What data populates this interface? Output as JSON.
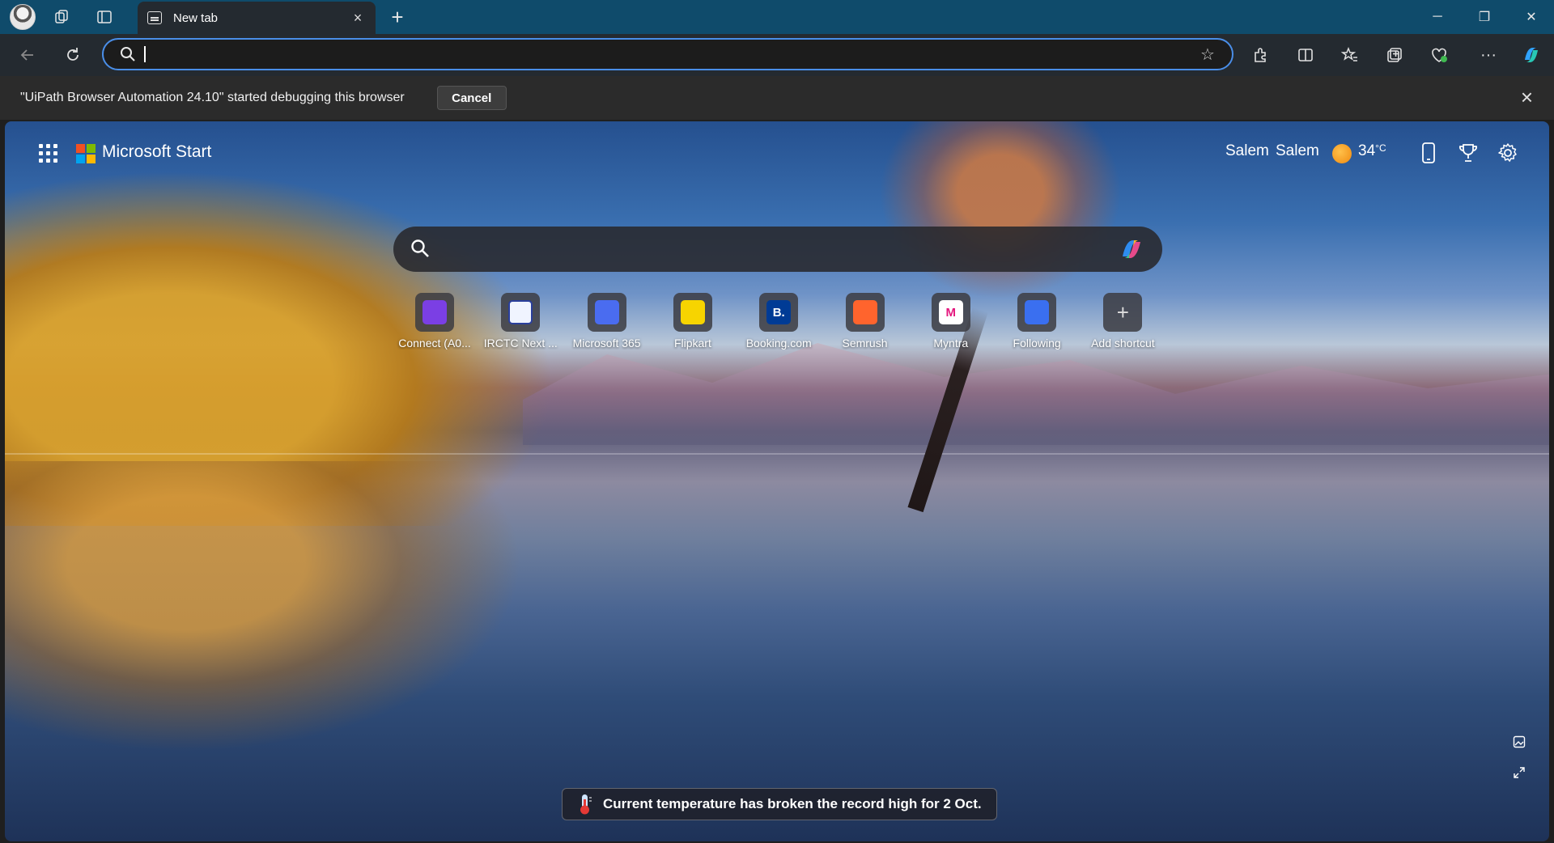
{
  "browser": {
    "tab": {
      "title": "New tab",
      "close": "×"
    },
    "new_tab_glyph": "+",
    "window_controls": {
      "minimize": "─",
      "restore": "❐",
      "close": "✕"
    },
    "address": {
      "value": "",
      "placeholder": ""
    }
  },
  "debug_bar": {
    "message": "\"UiPath Browser Automation 24.10\" started debugging this browser",
    "cancel_label": "Cancel",
    "close": "×"
  },
  "start_page": {
    "brand": "Microsoft Start",
    "weather": {
      "location_1": "Salem",
      "location_2": "Salem",
      "temperature": "34",
      "unit": "°C"
    },
    "search": {
      "placeholder": ""
    },
    "shortcuts": [
      {
        "label": "Connect (A0...",
        "icon": "connect-icon",
        "color": "#7b3fe4"
      },
      {
        "label": "IRCTC Next ...",
        "icon": "irctc-icon",
        "color": "#f0f4ff"
      },
      {
        "label": "Microsoft 365",
        "icon": "microsoft365-icon",
        "color": "#4a6cf0"
      },
      {
        "label": "Flipkart",
        "icon": "flipkart-icon",
        "color": "#f7d400"
      },
      {
        "label": "Booking.com",
        "icon": "booking-icon",
        "color": "#003b95",
        "glyph": "B."
      },
      {
        "label": "Semrush",
        "icon": "semrush-icon",
        "color": "#ff642d"
      },
      {
        "label": "Myntra",
        "icon": "myntra-icon",
        "color": "#ffffff",
        "glyph": "M"
      },
      {
        "label": "Following",
        "icon": "following-icon",
        "color": "#3a6ff0"
      },
      {
        "label": "Add shortcut",
        "icon": "add-icon",
        "color": "#5a5a60",
        "glyph": "+"
      }
    ],
    "news": "Current temperature has broken the record high for 2 Oct."
  }
}
